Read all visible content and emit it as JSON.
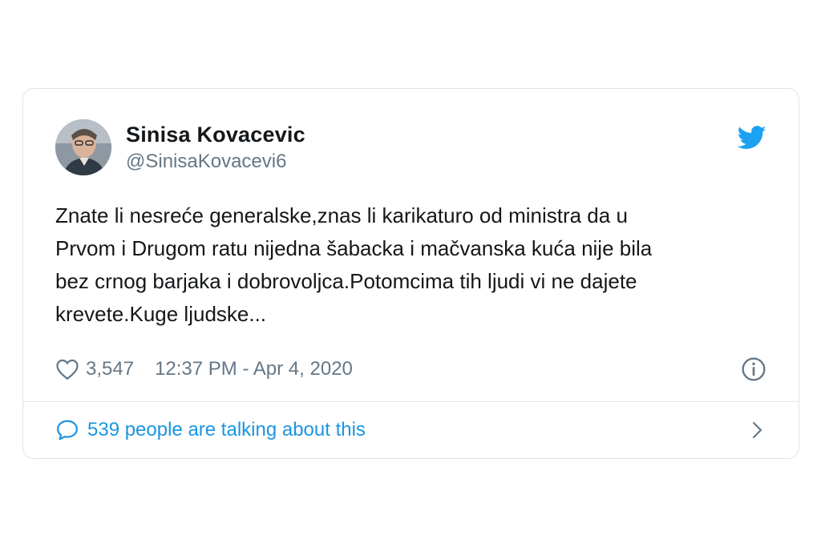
{
  "author": {
    "display_name": "Sinisa Kovacevic",
    "handle": "@SinisaKovacevi6",
    "avatar_icon": "avatar-photo"
  },
  "tweet": {
    "text": "Znate li nesreće generalske,znas li karikaturo od ministra da u\nPrvom i Drugom ratu nijedna šabacka i mačvanska kuća nije bila\nbez crnog barjaka i dobrovoljca.Potomcima tih ljudi vi ne dajete\nkrevete.Kuge ljudske..."
  },
  "meta": {
    "likes": "3,547",
    "timestamp": "12:37 PM - Apr 4, 2020"
  },
  "conversation": {
    "label": "539 people are talking about this"
  },
  "icons": {
    "brand": "twitter-bird-icon",
    "like": "heart-icon",
    "info": "info-icon",
    "reply": "speech-bubble-icon",
    "more": "chevron-right-icon"
  },
  "colors": {
    "brand_blue": "#1da1f2",
    "link_blue": "#1b95e0",
    "text_primary": "#14171a",
    "text_secondary": "#657786",
    "border": "#dde3e8"
  }
}
